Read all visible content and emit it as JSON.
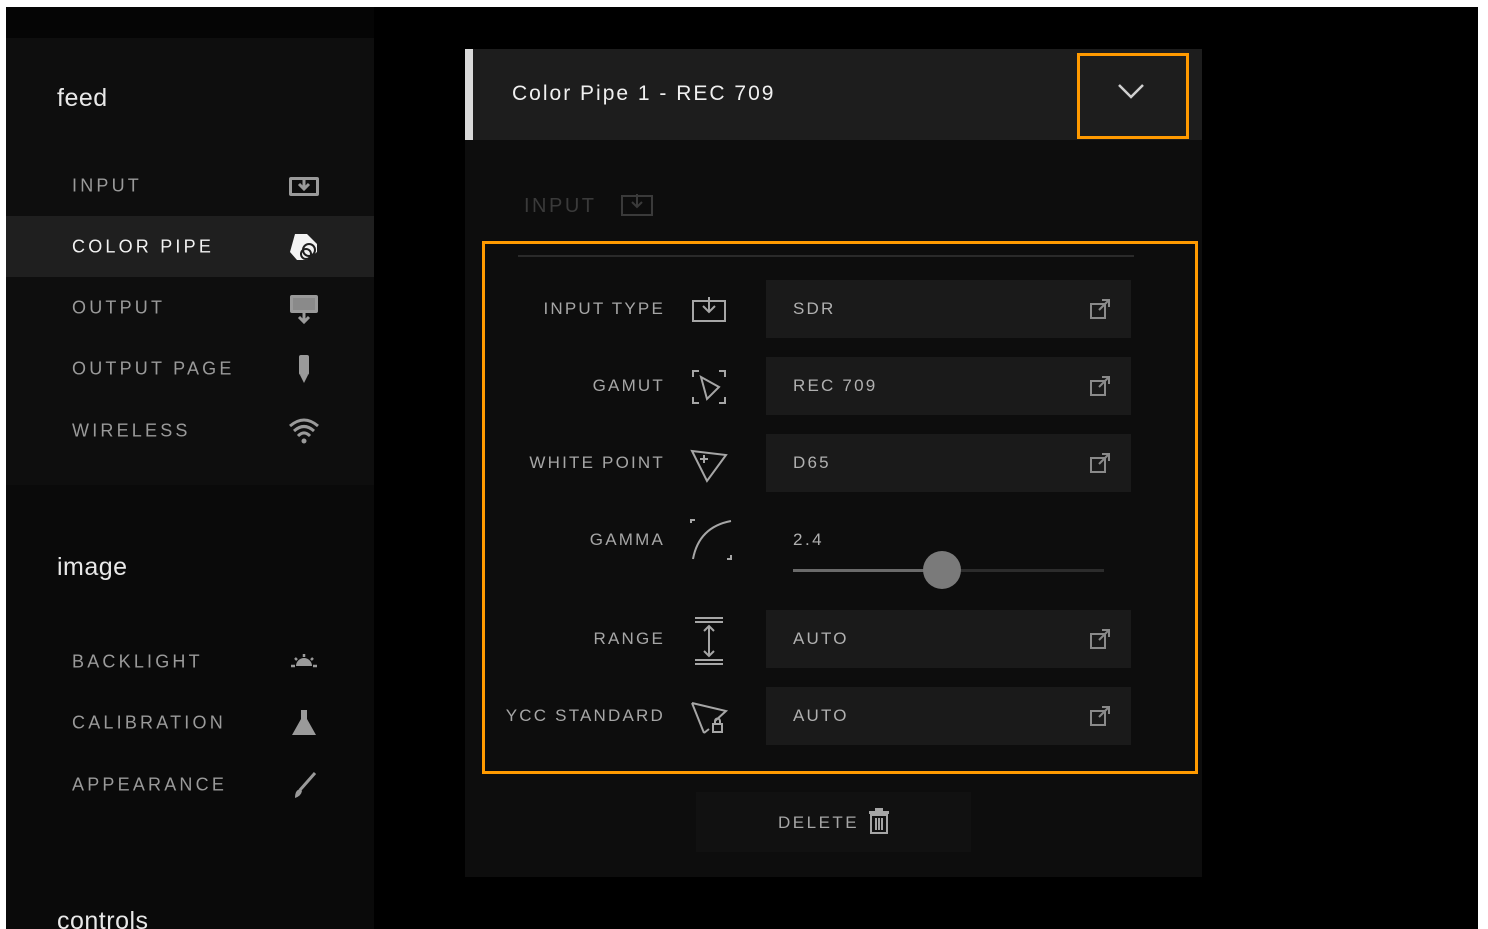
{
  "sidebar": {
    "sections": {
      "feed": "feed",
      "image": "image",
      "controls": "controls"
    },
    "feed_items": [
      {
        "label": "INPUT",
        "icon": "input-icon",
        "active": false
      },
      {
        "label": "COLOR PIPE",
        "icon": "color-pipe-icon",
        "active": true
      },
      {
        "label": "OUTPUT",
        "icon": "monitor-icon",
        "active": false
      },
      {
        "label": "OUTPUT PAGE",
        "icon": "output-page-icon",
        "active": false
      },
      {
        "label": "WIRELESS",
        "icon": "wifi-icon",
        "active": false
      }
    ],
    "image_items": [
      {
        "label": "BACKLIGHT",
        "icon": "backlight-icon"
      },
      {
        "label": "CALIBRATION",
        "icon": "calibration-icon"
      },
      {
        "label": "APPEARANCE",
        "icon": "brush-icon"
      }
    ]
  },
  "main": {
    "dropdown_title": "Color Pipe 1 - REC 709",
    "section_header": "INPUT",
    "rows": {
      "input_type": {
        "label": "INPUT TYPE",
        "value": "SDR"
      },
      "gamut": {
        "label": "GAMUT",
        "value": "REC 709"
      },
      "white_point": {
        "label": "WHITE POINT",
        "value": "D65"
      },
      "gamma": {
        "label": "GAMMA",
        "value": "2.4",
        "slider_fraction": 0.48
      },
      "range": {
        "label": "RANGE",
        "value": "AUTO"
      },
      "ycc_standard": {
        "label": "YCC STANDARD",
        "value": "AUTO"
      }
    },
    "delete_label": "DELETE"
  },
  "colors": {
    "accent_highlight": "#ff9a00",
    "background": "#000000",
    "active_item": "#1f1f1f"
  }
}
